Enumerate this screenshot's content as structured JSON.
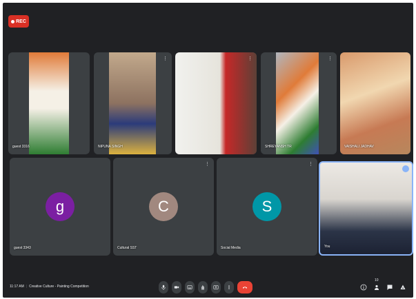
{
  "recording": {
    "label": "REC"
  },
  "participants": [
    {
      "name": "guest 3316"
    },
    {
      "name": "NIPUNA SINGH"
    },
    {
      "name": ""
    },
    {
      "name": "SHREYANSH TR"
    },
    {
      "name": "VAISHALI JADHAV"
    },
    {
      "name": "guest 3343",
      "initial": "g",
      "avatar_color": "#7b1fa2"
    },
    {
      "name": "Cultural SST",
      "initial": "C",
      "avatar_color": "#a1887f"
    },
    {
      "name": "Social Media",
      "initial": "S",
      "avatar_color": "#0097a7"
    },
    {
      "name": "You"
    }
  ],
  "bottom_bar": {
    "time": "11:17 AM",
    "meeting_title": "Creative Culture - Painting Competition",
    "participant_count": "10"
  }
}
